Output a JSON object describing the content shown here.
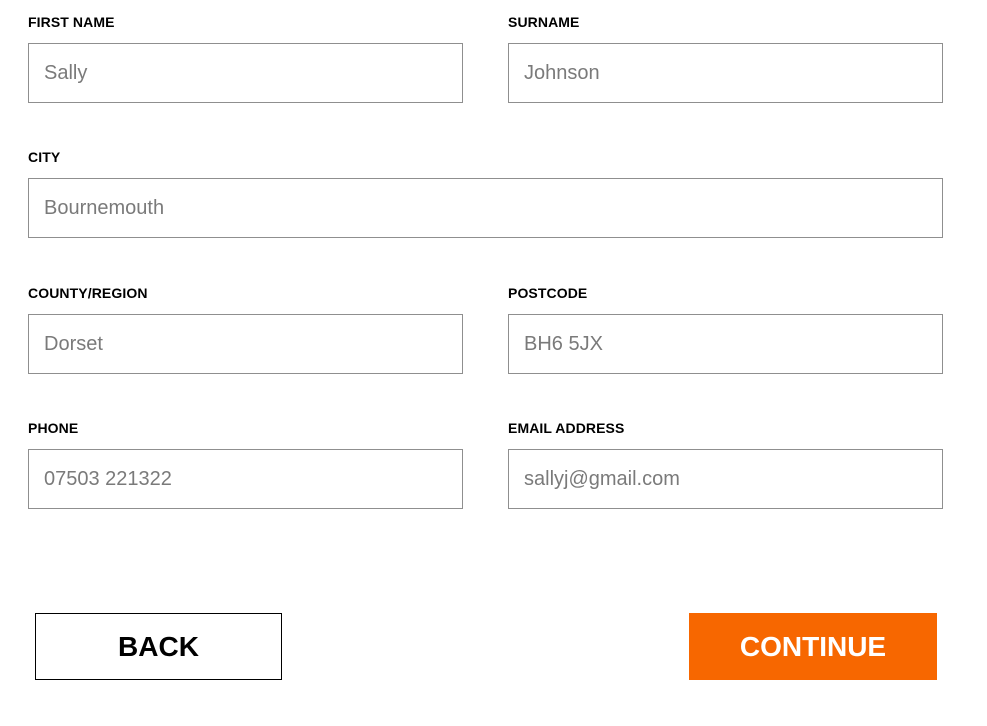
{
  "form": {
    "first_name": {
      "label": "FIRST NAME",
      "value": "Sally"
    },
    "surname": {
      "label": "SURNAME",
      "value": "Johnson"
    },
    "city": {
      "label": "CITY",
      "value": "Bournemouth"
    },
    "county": {
      "label": "COUNTY/REGION",
      "value": "Dorset"
    },
    "postcode": {
      "label": "POSTCODE",
      "value": "BH6 5JX"
    },
    "phone": {
      "label": "PHONE",
      "value": "07503 221322"
    },
    "email": {
      "label": "EMAIL ADDRESS",
      "value": "sallyj@gmail.com"
    }
  },
  "actions": {
    "back_label": "BACK",
    "continue_label": "CONTINUE"
  },
  "colors": {
    "accent": "#f76700",
    "input_border": "#8f8f8f",
    "input_text": "#7a7a7a"
  }
}
